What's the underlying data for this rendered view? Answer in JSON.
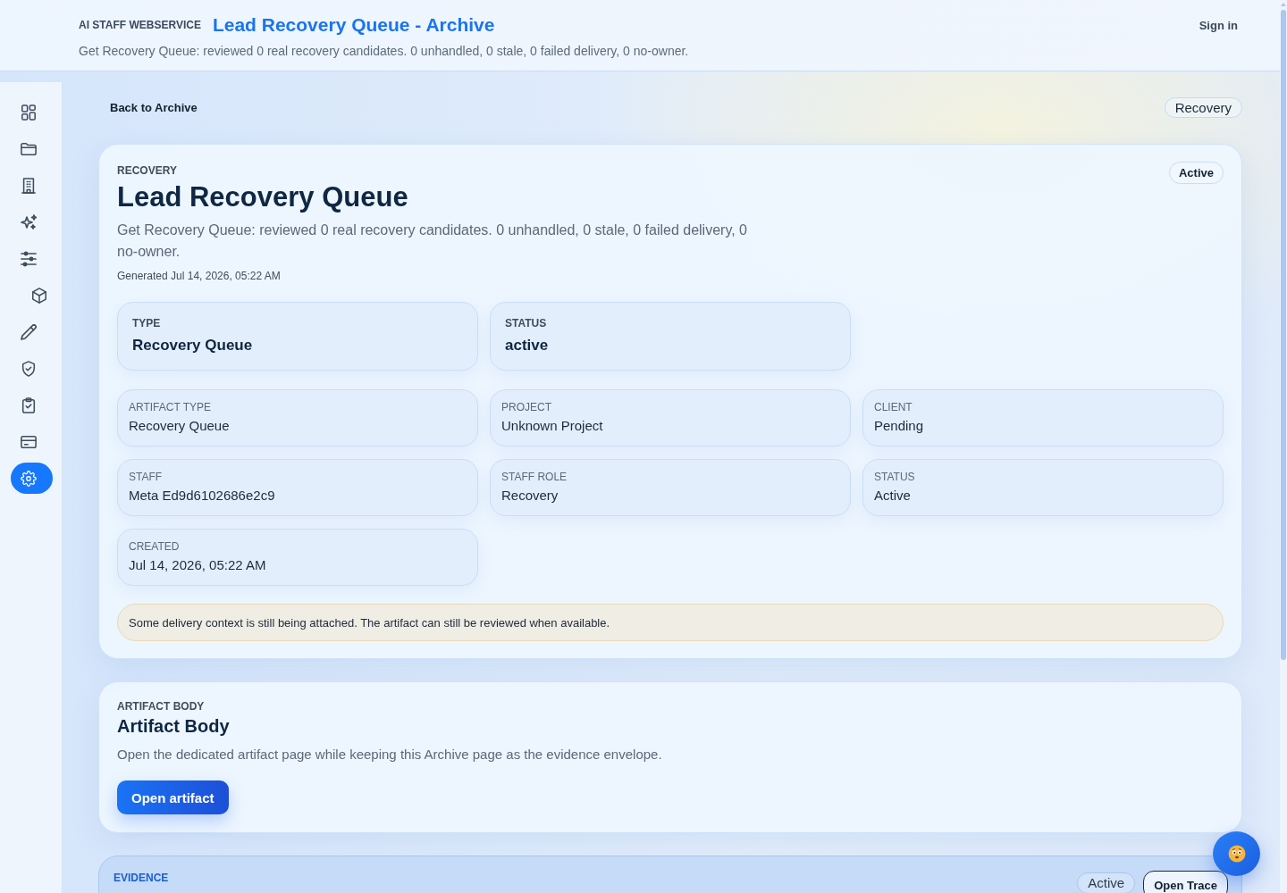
{
  "header": {
    "brand": "AI STAFF WEBSERVICE",
    "title": "Lead Recovery Queue - Archive",
    "summary": "Get Recovery Queue: reviewed 0 real recovery candidates. 0 unhandled, 0 stale, 0 failed delivery, 0 no-owner.",
    "sign_in": "Sign in"
  },
  "sidebar": {
    "items": [
      {
        "kind": "grid",
        "selected": false
      },
      {
        "kind": "folder",
        "selected": false
      },
      {
        "kind": "building",
        "selected": false
      },
      {
        "kind": "sparkles",
        "selected": false
      },
      {
        "kind": "sliders",
        "selected": false,
        "children": [
          {
            "kind": "cube",
            "selected": false
          }
        ]
      },
      {
        "kind": "pencil",
        "selected": false
      },
      {
        "kind": "shield",
        "selected": false
      },
      {
        "kind": "clipboard",
        "selected": false
      },
      {
        "kind": "card",
        "selected": false
      },
      {
        "kind": "gear",
        "selected": true
      }
    ]
  },
  "toolbar": {
    "back_link": "Back to Archive",
    "tag": "Recovery"
  },
  "summary": {
    "eyebrow": "RECOVERY",
    "title": "Lead Recovery Queue",
    "status_badge": "Active",
    "description": "Get Recovery Queue: reviewed 0 real recovery candidates. 0 unhandled, 0 stale, 0 failed delivery, 0 no-owner.",
    "generated": "Generated Jul 14, 2026, 05:22 AM",
    "primary_fields": [
      {
        "label": "TYPE",
        "value": "Recovery Queue"
      },
      {
        "label": "STATUS",
        "value": "active"
      }
    ],
    "fields": [
      {
        "label": "ARTIFACT TYPE",
        "value": "Recovery Queue"
      },
      {
        "label": "PROJECT",
        "value": "Unknown Project"
      },
      {
        "label": "CLIENT",
        "value": "Pending"
      },
      {
        "label": "STAFF",
        "value": "Meta Ed9d6102686e2c9"
      },
      {
        "label": "STAFF ROLE",
        "value": "Recovery"
      },
      {
        "label": "STATUS",
        "value": "Active"
      },
      {
        "label": "CREATED",
        "value": "Jul 14, 2026, 05:22 AM"
      }
    ],
    "notice": "Some delivery context is still being attached. The artifact can still be reviewed when available."
  },
  "artifact_body": {
    "eyebrow": "ARTIFACT BODY",
    "title": "Artifact Body",
    "description": "Open the dedicated artifact page while keeping this Archive page as the evidence envelope.",
    "button": "Open artifact"
  },
  "evidence": {
    "eyebrow": "EVIDENCE",
    "status_badge": "Active",
    "button": "Open Trace"
  }
}
